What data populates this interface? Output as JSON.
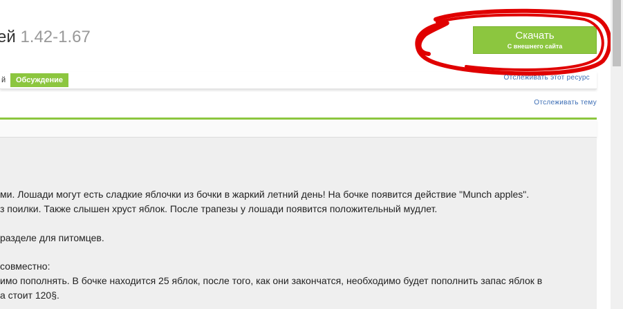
{
  "resource": {
    "title_fragment": "ей",
    "version": "1.42-1.67"
  },
  "download": {
    "label": "Скачать",
    "sublabel": "С внешнего сайта"
  },
  "tabs": {
    "prev_fragment": "й",
    "active": "Обсуждение"
  },
  "links": {
    "watch_resource": "Отслеживать этот ресурс",
    "watch_thread": "Отслеживать тему"
  },
  "post": {
    "lines": [
      "ми. Лошади могут есть сладкие яблочки из бочки в жаркий летний день! На бочке появится действие \"Munch apples\".",
      "з поилки. Также слышен хруст яблок. После трапезы у лошади появится положительный мудлет.",
      "разделе для питомцев.",
      "совместно:",
      "имо пополнять. В бочке находится 25 яблок, после того, как они закончатся, необходимо будет пополнить запас яблок в",
      "а стоит 120§."
    ]
  },
  "colors": {
    "accent_green": "#8cc63f",
    "link_blue": "#3b6db5",
    "annotation_red": "#e00000"
  }
}
